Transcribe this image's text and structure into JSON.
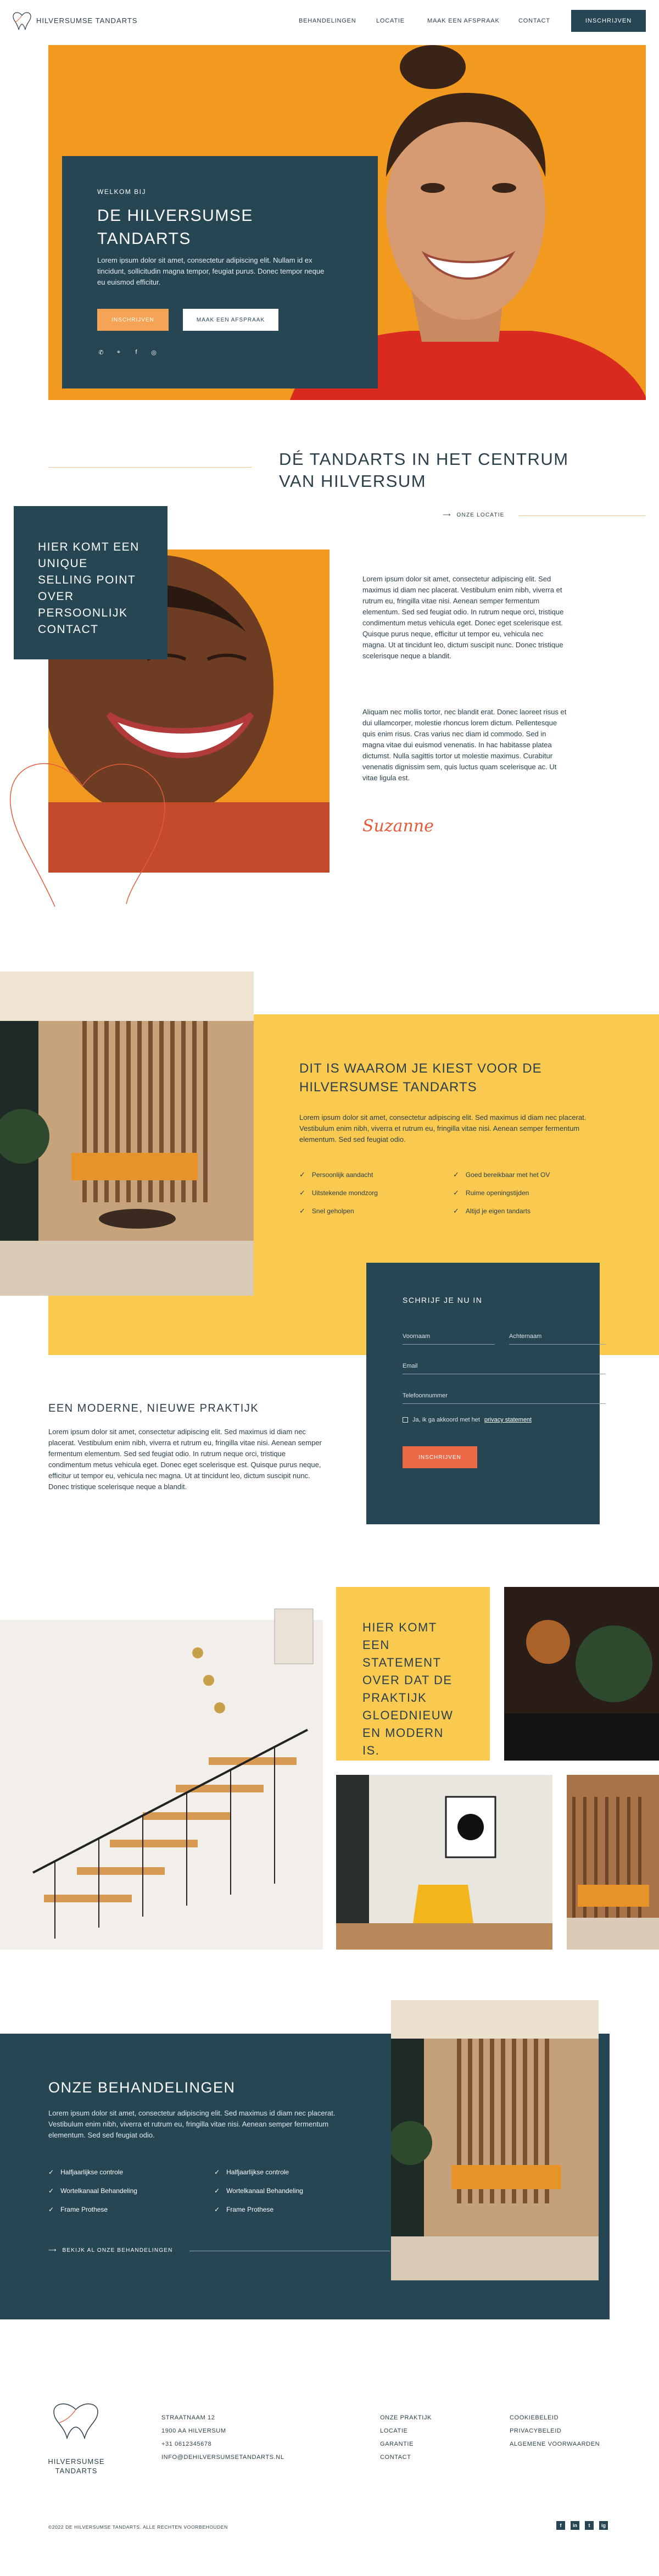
{
  "brand": {
    "name": "HILVERSUMSE TANDARTS",
    "footer_name_line1": "HILVERSUMSE",
    "footer_name_line2": "TANDARTS",
    "colors": {
      "navy": "#264653",
      "orange": "#f19a1f",
      "yellow": "#f9ca4f",
      "coral": "#ec6a47"
    }
  },
  "nav": {
    "items": [
      "BEHANDELINGEN",
      "LOCATIE",
      "MAAK EEN AFSPRAAK",
      "CONTACT"
    ],
    "cta": "INSCHRIJVEN"
  },
  "hero": {
    "kicker": "WELKOM BIJ",
    "title": "DE HILVERSUMSE TANDARTS",
    "text": "Lorem ipsum dolor sit amet, consectetur adipiscing elit. Nullam id ex tincidunt, sollicitudin magna tempor, feugiat purus. Donec tempor neque eu euismod efficitur.",
    "primary_button": "INSCHRIJVEN",
    "secondary_button": "MAAK EEN AFSPRAAK",
    "social_icons": [
      "phone-icon",
      "location-icon",
      "facebook-icon",
      "instagram-icon"
    ]
  },
  "intro": {
    "title": "DÉ TANDARTS IN HET CENTRUM VAN HILVERSUM",
    "location_link": "ONZE LOCATIE",
    "usp": "HIER KOMT EEN UNIQUE SELLING POINT OVER PERSOONLIJK CONTACT",
    "paragraph1": "Lorem ipsum dolor sit amet, consectetur adipiscing elit. Sed maximus id diam nec placerat. Vestibulum enim nibh, viverra et rutrum eu, fringilla vitae nisi. Aenean semper fermentum elementum. Sed sed feugiat odio. In rutrum neque orci, tristique condimentum metus vehicula eget. Donec eget scelerisque est. Quisque purus neque, efficitur ut tempor eu, vehicula nec magna. Ut at tincidunt leo, dictum suscipit nunc. Donec tristique scelerisque neque a blandit.",
    "paragraph2": "Aliquam nec mollis tortor, nec blandit erat. Donec laoreet risus et dui ullamcorper, molestie rhoncus lorem dictum. Pellentesque quis enim risus. Cras varius nec diam id commodo. Sed in magna vitae dui euismod venenatis. In hac habitasse platea dictumst. Nulla sagittis tortor ut molestie maximus. Curabitur venenatis dignissim sem, quis luctus quam scelerisque ac. Ut vitae ligula est.",
    "signature": "Suzanne"
  },
  "why": {
    "title": "DIT IS WAAROM JE KIEST VOOR DE HILVERSUMSE TANDARTS",
    "text": "Lorem ipsum dolor sit amet, consectetur adipiscing elit. Sed maximus id diam nec placerat. Vestibulum enim nibh, viverra et rutrum eu, fringilla vitae nisi. Aenean semper fermentum elementum. Sed sed feugiat odio.",
    "checks_left": [
      "Persoonlijk aandacht",
      "Uitstekende mondzorg",
      "Snel geholpen"
    ],
    "checks_right": [
      "Goed bereikbaar met het OV",
      "Ruime openingstijden",
      "Altijd je eigen tandarts"
    ]
  },
  "form": {
    "title": "SCHRIJF JE NU IN",
    "first_name": "Voornaam",
    "last_name": "Achternaam",
    "email": "Email",
    "phone": "Telefoonnummer",
    "consent_prefix": "Ja, ik ga akkoord met het",
    "consent_link": "privacy statement",
    "submit": "INSCHRIJVEN"
  },
  "practice": {
    "title": "EEN MODERNE, NIEUWE PRAKTIJK",
    "text": "Lorem ipsum dolor sit amet, consectetur adipiscing elit. Sed maximus id diam nec placerat. Vestibulum enim nibh, viverra et rutrum eu, fringilla vitae nisi. Aenean semper fermentum elementum. Sed sed feugiat odio. In rutrum neque orci, tristique condimentum metus vehicula eget. Donec eget scelerisque est. Quisque purus neque, efficitur ut tempor eu, vehicula nec magna. Ut at tincidunt leo, dictum suscipit nunc. Donec tristique scelerisque neque a blandit."
  },
  "gallery": {
    "statement": "HIER KOMT EEN STATEMENT OVER DAT DE PRAKTIJK GLOEDNIEUW EN MODERN IS."
  },
  "treatments": {
    "title": "ONZE BEHANDELINGEN",
    "text": "Lorem ipsum dolor sit amet, consectetur adipiscing elit. Sed maximus id diam nec placerat. Vestibulum enim nibh, viverra et rutrum eu, fringilla vitae nisi. Aenean semper fermentum elementum. Sed sed feugiat odio.",
    "checks_left": [
      "Halfjaarlijkse controle",
      "Wortelkanaal Behandeling",
      "Frame Prothese"
    ],
    "checks_right": [
      "Halfjaarlijkse controle",
      "Wortelkanaal Behandeling",
      "Frame Prothese"
    ],
    "link": "BEKIJK AL ONZE BEHANDELINGEN"
  },
  "footer": {
    "address": [
      "STRAATNAAM 12",
      "1900 AA HILVERSUM",
      "+31 0612345678",
      "INFO@DEHILVERSUMSETANDARTS.NL"
    ],
    "col2": [
      "ONZE PRAKTIJK",
      "LOCATIE",
      "GARANTIE",
      "CONTACT"
    ],
    "col3": [
      "COOKIEBELEID",
      "PRIVACYBELEID",
      "ALGEMENE VOORWAARDEN"
    ],
    "copyright": "©2022 DE HILVERSUMSE TANDARTS. ALLE RECHTEN VOORBEHOUDEN",
    "social": [
      "f",
      "in",
      "t",
      "ig"
    ]
  }
}
